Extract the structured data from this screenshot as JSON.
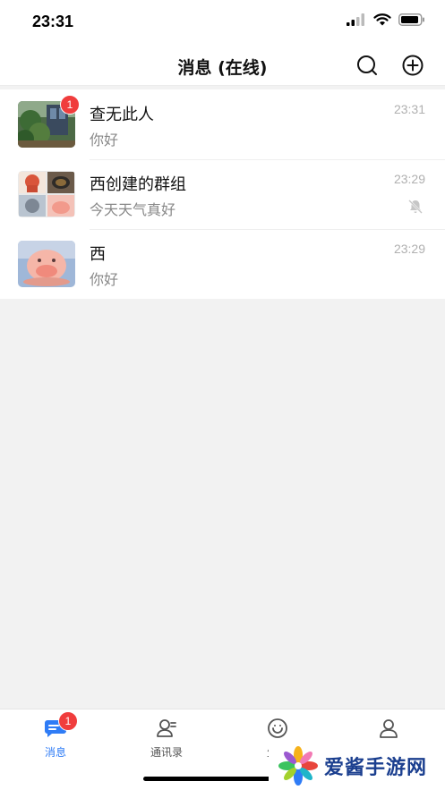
{
  "status_bar": {
    "time": "23:31"
  },
  "nav": {
    "title": "消息 (在线)"
  },
  "chats": [
    {
      "name": "查无此人",
      "message": "你好",
      "time": "23:31",
      "unread": "1",
      "muted": false
    },
    {
      "name": "西创建的群组",
      "message": "今天天气真好",
      "time": "23:29",
      "unread": "",
      "muted": true
    },
    {
      "name": "西",
      "message": "你好",
      "time": "23:29",
      "unread": "",
      "muted": false
    }
  ],
  "tabs": [
    {
      "label": "消息",
      "badge": "1",
      "active": true,
      "icon": "chat-icon"
    },
    {
      "label": "通讯录",
      "active": false,
      "icon": "contacts-icon"
    },
    {
      "label": "生活",
      "active": false,
      "icon": "smile-icon"
    },
    {
      "label": "我的",
      "active": false,
      "icon": "profile-icon"
    }
  ],
  "watermark": {
    "text": "爱酱手游网"
  },
  "colors": {
    "accent": "#2f7cf6",
    "badge": "#f03d3d",
    "background": "#f2f2f2"
  }
}
